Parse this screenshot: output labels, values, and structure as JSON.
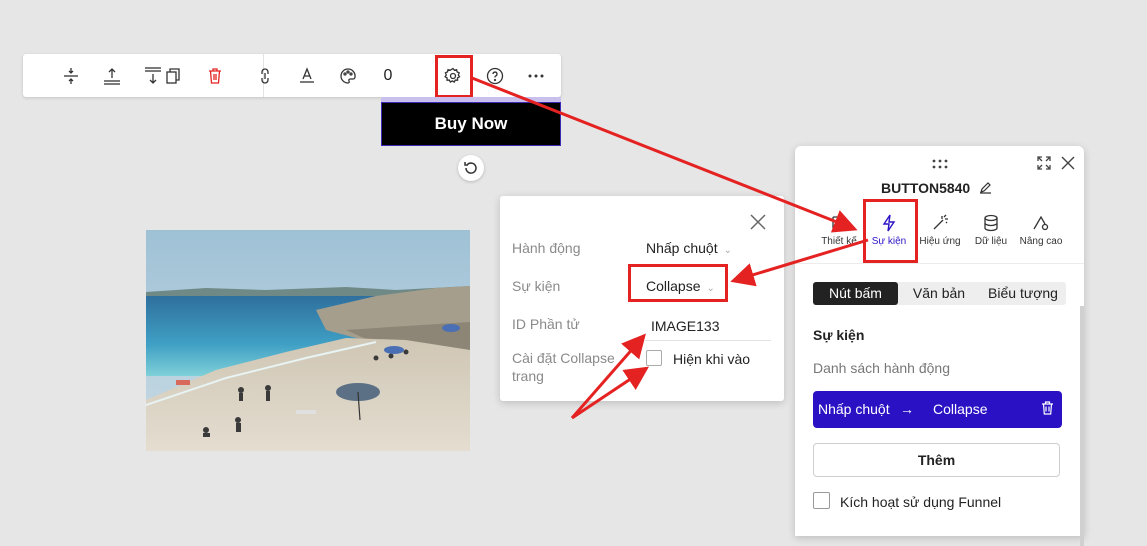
{
  "toolbar": {
    "icons": [
      "spacing-icon",
      "move-up-icon",
      "move-down-icon",
      "duplicate-icon",
      "delete-icon",
      "link-icon",
      "text-style-icon",
      "palette-icon",
      "settings-icon",
      "help-icon",
      "more-icon"
    ],
    "count": "0"
  },
  "canvas": {
    "button_text": "Buy Now"
  },
  "popup": {
    "rows": [
      {
        "label": "Hành động",
        "value": "Nhấp chuột"
      },
      {
        "label": "Sự kiện",
        "value": "Collapse"
      },
      {
        "label": "ID Phần tử",
        "value": "IMAGE133"
      },
      {
        "label": "Cài đặt Collapse trang",
        "value": "Hiện khi vào"
      }
    ]
  },
  "panel": {
    "title": "BUTTON5840",
    "tabs": [
      {
        "label": "Thiết kế",
        "icon": "design-icon"
      },
      {
        "label": "Sự kiện",
        "icon": "lightning-icon"
      },
      {
        "label": "Hiệu ứng",
        "icon": "magic-wand-icon"
      },
      {
        "label": "Dữ liệu",
        "icon": "database-icon"
      },
      {
        "label": "Nâng cao",
        "icon": "advanced-settings-icon"
      }
    ],
    "active_tab": "Sự kiện",
    "segments": [
      "Nút bấm",
      "Văn bản",
      "Biểu tượng"
    ],
    "section_title": "Sự kiện",
    "section_subtitle": "Danh sách hành động",
    "action": {
      "trigger": "Nhấp chuột",
      "arrow": "→",
      "event": "Collapse"
    },
    "add_label": "Thêm",
    "funnel_label": "Kích hoạt sử dụng Funnel"
  },
  "colors": {
    "accent": "#2a12c4",
    "highlight": "#e52222",
    "button_bg": "#000000"
  }
}
